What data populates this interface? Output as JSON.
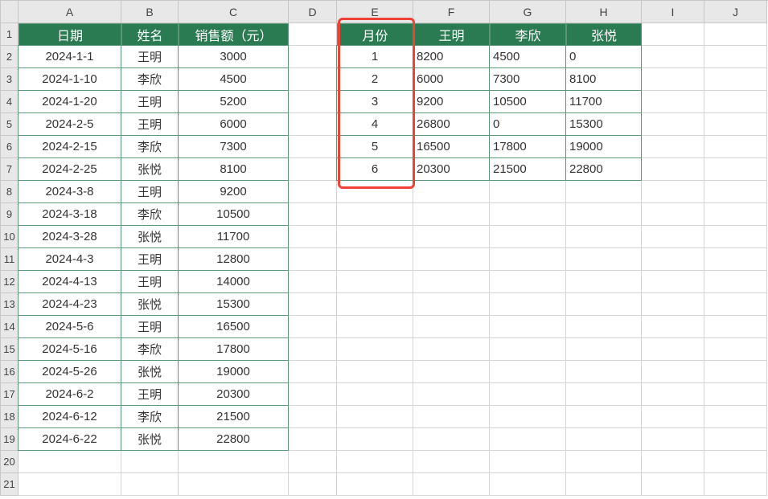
{
  "columns": [
    "A",
    "B",
    "C",
    "D",
    "E",
    "F",
    "G",
    "H",
    "I",
    "J"
  ],
  "rows": [
    "1",
    "2",
    "3",
    "4",
    "5",
    "6",
    "7",
    "8",
    "9",
    "10",
    "11",
    "12",
    "13",
    "14",
    "15",
    "16",
    "17",
    "18",
    "19",
    "20",
    "21"
  ],
  "table1": {
    "headers": [
      "日期",
      "姓名",
      "销售额（元）"
    ],
    "data": [
      [
        "2024-1-1",
        "王明",
        "3000"
      ],
      [
        "2024-1-10",
        "李欣",
        "4500"
      ],
      [
        "2024-1-20",
        "王明",
        "5200"
      ],
      [
        "2024-2-5",
        "王明",
        "6000"
      ],
      [
        "2024-2-15",
        "李欣",
        "7300"
      ],
      [
        "2024-2-25",
        "张悦",
        "8100"
      ],
      [
        "2024-3-8",
        "王明",
        "9200"
      ],
      [
        "2024-3-18",
        "李欣",
        "10500"
      ],
      [
        "2024-3-28",
        "张悦",
        "11700"
      ],
      [
        "2024-4-3",
        "王明",
        "12800"
      ],
      [
        "2024-4-13",
        "王明",
        "14000"
      ],
      [
        "2024-4-23",
        "张悦",
        "15300"
      ],
      [
        "2024-5-6",
        "王明",
        "16500"
      ],
      [
        "2024-5-16",
        "李欣",
        "17800"
      ],
      [
        "2024-5-26",
        "张悦",
        "19000"
      ],
      [
        "2024-6-2",
        "王明",
        "20300"
      ],
      [
        "2024-6-12",
        "李欣",
        "21500"
      ],
      [
        "2024-6-22",
        "张悦",
        "22800"
      ]
    ]
  },
  "table2": {
    "headers": [
      "月份",
      "王明",
      "李欣",
      "张悦"
    ],
    "data": [
      [
        "1",
        "8200",
        "4500",
        "0"
      ],
      [
        "2",
        "6000",
        "7300",
        "8100"
      ],
      [
        "3",
        "9200",
        "10500",
        "11700"
      ],
      [
        "4",
        "26800",
        "0",
        "15300"
      ],
      [
        "5",
        "16500",
        "17800",
        "19000"
      ],
      [
        "6",
        "20300",
        "21500",
        "22800"
      ]
    ]
  },
  "chart_data": [
    {
      "type": "table",
      "title": "日期/姓名/销售额",
      "columns": [
        "日期",
        "姓名",
        "销售额（元）"
      ],
      "rows": [
        [
          "2024-1-1",
          "王明",
          3000
        ],
        [
          "2024-1-10",
          "李欣",
          4500
        ],
        [
          "2024-1-20",
          "王明",
          5200
        ],
        [
          "2024-2-5",
          "王明",
          6000
        ],
        [
          "2024-2-15",
          "李欣",
          7300
        ],
        [
          "2024-2-25",
          "张悦",
          8100
        ],
        [
          "2024-3-8",
          "王明",
          9200
        ],
        [
          "2024-3-18",
          "李欣",
          10500
        ],
        [
          "2024-3-28",
          "张悦",
          11700
        ],
        [
          "2024-4-3",
          "王明",
          12800
        ],
        [
          "2024-4-13",
          "王明",
          14000
        ],
        [
          "2024-4-23",
          "张悦",
          15300
        ],
        [
          "2024-5-6",
          "王明",
          16500
        ],
        [
          "2024-5-16",
          "李欣",
          17800
        ],
        [
          "2024-5-26",
          "张悦",
          19000
        ],
        [
          "2024-6-2",
          "王明",
          20300
        ],
        [
          "2024-6-12",
          "李欣",
          21500
        ],
        [
          "2024-6-22",
          "张悦",
          22800
        ]
      ]
    },
    {
      "type": "table",
      "title": "月份汇总",
      "columns": [
        "月份",
        "王明",
        "李欣",
        "张悦"
      ],
      "rows": [
        [
          1,
          8200,
          4500,
          0
        ],
        [
          2,
          6000,
          7300,
          8100
        ],
        [
          3,
          9200,
          10500,
          11700
        ],
        [
          4,
          26800,
          0,
          15300
        ],
        [
          5,
          16500,
          17800,
          19000
        ],
        [
          6,
          20300,
          21500,
          22800
        ]
      ]
    }
  ]
}
